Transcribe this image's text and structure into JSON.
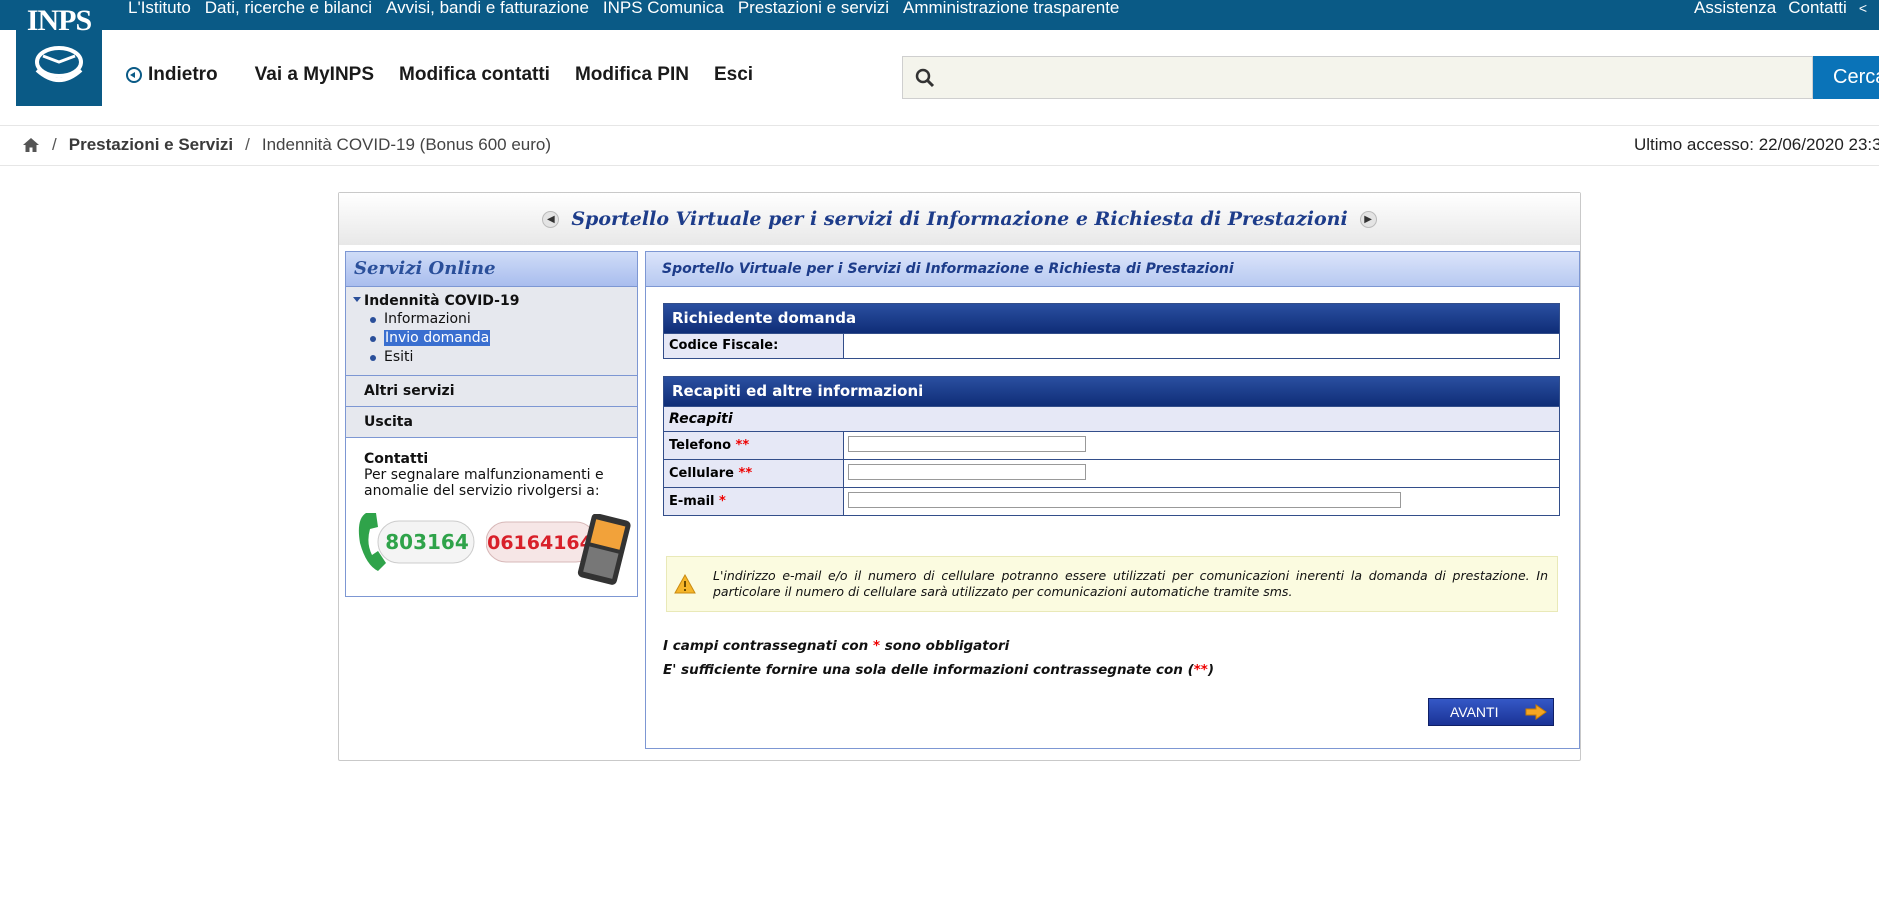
{
  "top_nav": {
    "items": [
      "L'Istituto",
      "Dati, ricerche e bilanci",
      "Avvisi, bandi e fatturazione",
      "INPS Comunica",
      "Prestazioni e servizi",
      "Amministrazione trasparente"
    ],
    "right_items": [
      "Assistenza",
      "Contatti"
    ]
  },
  "logo": {
    "text": "INPS"
  },
  "main_nav": {
    "back_label": "Indietro",
    "items": [
      "Vai a MyINPS",
      "Modifica contatti",
      "Modifica PIN",
      "Esci"
    ]
  },
  "search": {
    "value": "",
    "placeholder": "",
    "button_label": "Cerca"
  },
  "breadcrumb": {
    "items": [
      "Prestazioni e Servizi",
      "Indennità COVID-19 (Bonus 600 euro)"
    ],
    "separator": "/"
  },
  "last_access": "Ultimo accesso: 22/06/2020 23:3",
  "frame": {
    "title": "Sportello Virtuale per i servizi di Informazione e Richiesta di Prestazioni"
  },
  "left_panel": {
    "title": "Servizi Online",
    "section": "Indennità COVID-19",
    "sub_items": [
      "Informazioni",
      "Invio domanda",
      "Esiti"
    ],
    "selected_index": 1,
    "other_items": [
      "Altri servizi",
      "Uscita"
    ],
    "contacts_title": "Contatti",
    "contacts_text": "Per segnalare malfunzionamenti e anomalie del servizio rivolgersi a:",
    "phone_landline": "803164",
    "phone_mobile": "06164164"
  },
  "right_panel": {
    "title": "Sportello Virtuale per i Servizi di Informazione e Richiesta di Prestazioni",
    "applicant": {
      "header": "Richiedente domanda",
      "fiscal_code_label": "Codice Fiscale:",
      "fiscal_code_value": ""
    },
    "contacts": {
      "header": "Recapiti ed altre informazioni",
      "subheader": "Recapiti",
      "phone_label": "Telefono",
      "phone_marker": "**",
      "phone_value": "",
      "mobile_label": "Cellulare",
      "mobile_marker": "**",
      "mobile_value": "",
      "email_label": "E-mail",
      "email_marker": "*",
      "email_value": ""
    },
    "warning": "L'indirizzo e-mail e/o il numero di cellulare potranno essere utilizzati per comunicazioni inerenti la domanda di prestazione. In particolare il numero di cellulare sarà utilizzato per comunicazioni automatiche tramite sms.",
    "note1_a": "I campi contrassegnati con ",
    "note1_marker": "*",
    "note1_b": " sono obbligatori",
    "note2_a": "E' sufficiente fornire una sola delle informazioni contrassegnate con (",
    "note2_marker": "**",
    "note2_b": ")",
    "next_button": "AVANTI"
  },
  "colors": {
    "brand": "#0a5a86",
    "panel_border": "#7d97d3",
    "table_header": "#1b3b8a",
    "required": "#e00000"
  }
}
